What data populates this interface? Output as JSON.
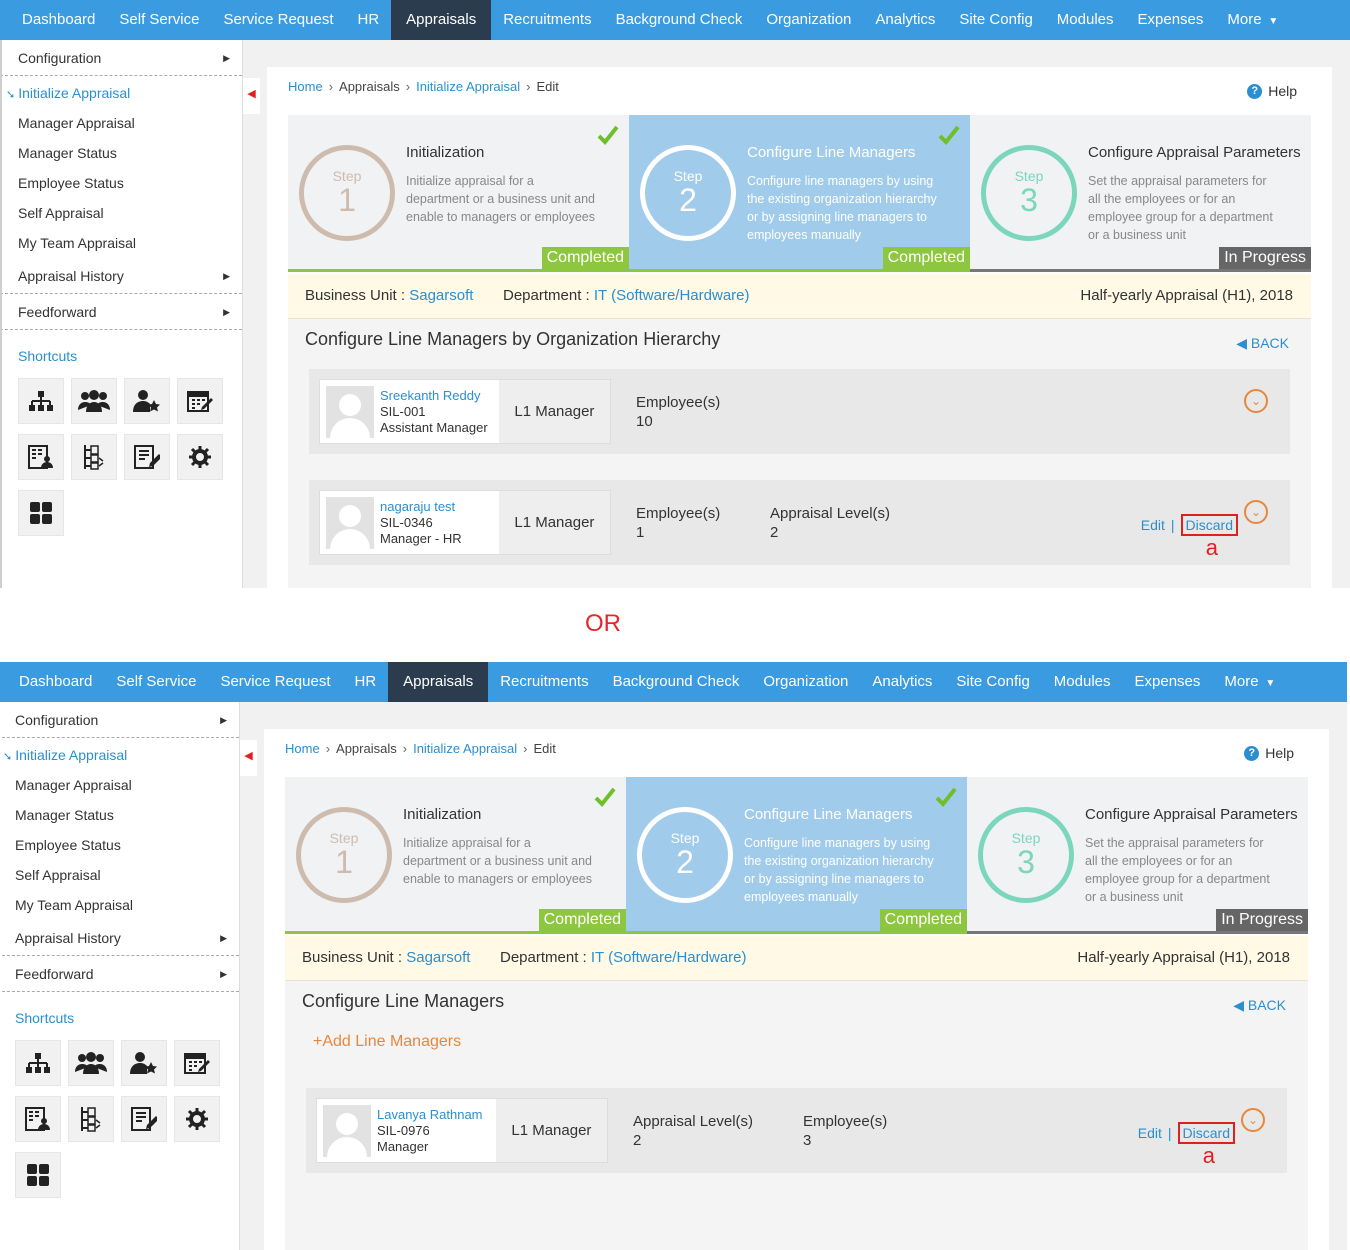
{
  "nav": {
    "items": [
      "Dashboard",
      "Self Service",
      "Service Request",
      "HR",
      "Appraisals",
      "Recruitments",
      "Background Check",
      "Organization",
      "Analytics",
      "Site Config",
      "Modules",
      "Expenses",
      "More"
    ],
    "active": "Appraisals"
  },
  "sidebar": {
    "configuration": "Configuration",
    "items": [
      "Initialize Appraisal",
      "Manager Appraisal",
      "Manager Status",
      "Employee Status",
      "Self Appraisal",
      "My Team Appraisal"
    ],
    "appraisal_history": "Appraisal History",
    "feedforward": "Feedforward",
    "shortcuts": "Shortcuts"
  },
  "breadcrumb": {
    "home": "Home",
    "appraisals": "Appraisals",
    "initialize": "Initialize Appraisal",
    "edit": "Edit"
  },
  "help": "Help",
  "steps": [
    {
      "step_word": "Step",
      "number": "1",
      "title": "Initialization",
      "desc": "Initialize appraisal for a department or a business unit and enable to managers or employees",
      "status": "Completed"
    },
    {
      "step_word": "Step",
      "number": "2",
      "title": "Configure Line Managers",
      "desc": "Configure line managers by using the existing organization hierarchy or by assigning line managers to employees manually",
      "status": "Completed"
    },
    {
      "step_word": "Step",
      "number": "3",
      "title": "Configure Appraisal Parameters",
      "desc": "Set the appraisal parameters for all the employees or for an employee group for a department or a business unit",
      "status": "In Progress"
    }
  ],
  "business": {
    "bu_label": "Business Unit :",
    "bu_value": "Sagarsoft",
    "dept_label": "Department :",
    "dept_value": "IT (Software/Hardware)",
    "cycle": "Half-yearly Appraisal (H1), 2018"
  },
  "separator": "OR",
  "panel1": {
    "title": "Configure Line Managers by Organization Hierarchy",
    "back": "BACK",
    "cards": [
      {
        "name": "Sreekanth Reddy",
        "id": "SIL-001",
        "designation": "Assistant Manager",
        "role": "L1 Manager",
        "col1_label": "Employee(s)",
        "col1_value": "10"
      },
      {
        "name": "nagaraju test",
        "id": "SIL-0346",
        "designation": "Manager - HR",
        "role": "L1 Manager",
        "col1_label": "Employee(s)",
        "col1_value": "1",
        "col2_label": "Appraisal Level(s)",
        "col2_value": "2",
        "edit": "Edit",
        "discard": "Discard",
        "annotation": "a"
      }
    ]
  },
  "panel2": {
    "title": "Configure Line Managers",
    "back": "BACK",
    "add": "+Add Line Managers",
    "card": {
      "name": "Lavanya Rathnam",
      "id": "SIL-0976",
      "designation": "Manager",
      "role": "L1 Manager",
      "col1_label": "Appraisal Level(s)",
      "col1_value": "2",
      "col2_label": "Employee(s)",
      "col2_value": "3",
      "edit": "Edit",
      "discard": "Discard",
      "annotation": "a"
    }
  }
}
